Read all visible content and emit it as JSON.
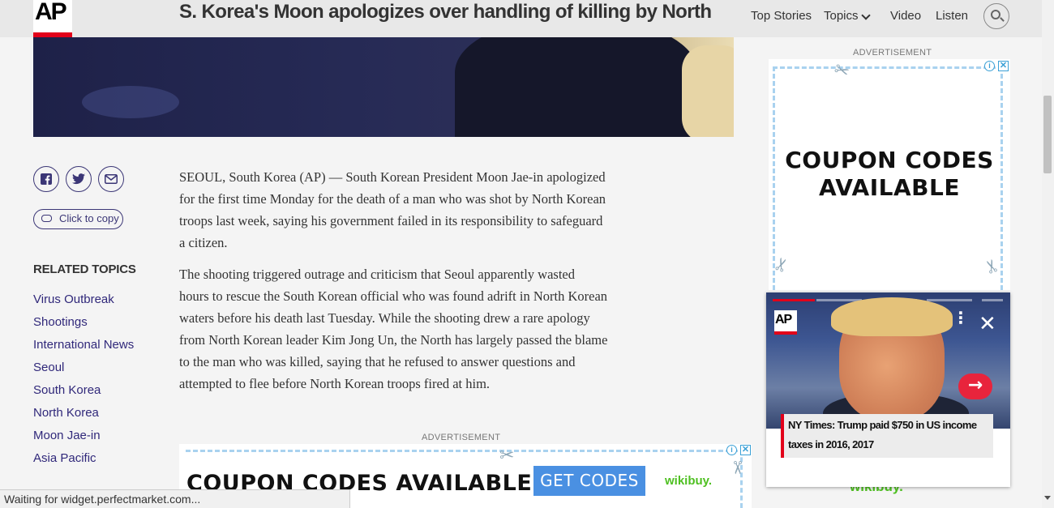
{
  "header": {
    "logo_text": "AP",
    "headline": "S. Korea's Moon apologizes over handling of killing by North",
    "nav": {
      "top_stories": "Top Stories",
      "topics": "Topics",
      "video": "Video",
      "listen": "Listen"
    }
  },
  "share": {
    "facebook_icon": "facebook-icon",
    "twitter_icon": "twitter-icon",
    "email_icon": "mail-icon",
    "copy_label": "Click to copy"
  },
  "related_topics": {
    "heading": "RELATED TOPICS",
    "items": [
      "Virus Outbreak",
      "Shootings",
      "International News",
      "Seoul",
      "South Korea",
      "North Korea",
      "Moon Jae-in",
      "Asia Pacific"
    ]
  },
  "article": {
    "paragraph_1_lines": [
      "SEOUL, South Korea (AP) — South Korean President Moon Jae-in apologized",
      "for the first time Monday for the death of a man who was shot by North Korean",
      "troops last week, saying his government failed in its responsibility to safeguard",
      "a citizen."
    ],
    "paragraph_2_lines": [
      "The shooting triggered outrage and criticism that Seoul apparently wasted",
      "hours to rescue the South Korean official who was found adrift in North Korean",
      "waters before his death last Tuesday. While the shooting drew a rare apology",
      "from North Korean leader Kim Jong Un, the North has largely passed the blame",
      "to the man who was killed, saying that he refused to answer questions and",
      "attempted to flee before North Korean troops fired at him."
    ]
  },
  "ads": {
    "label": "ADVERTISEMENT",
    "bottom": {
      "coupon_text": "COUPON CODES AVAILABLE",
      "button_label": "GET CODES",
      "brand": "wikibuy."
    },
    "right": {
      "coupon_line_1": "COUPON CODES",
      "coupon_line_2": "AVAILABLE",
      "brand": "wikibuy."
    },
    "adchoices_info": "i",
    "adchoices_close": "✕"
  },
  "video_widget": {
    "logo_text": "AP",
    "caption": "NY Times: Trump paid $750 in US income taxes in 2016, 2017",
    "kebab_glyph": "⋮",
    "close_glyph": "✕",
    "next_glyph": "→"
  },
  "status_bar": {
    "text": "Waiting for widget.perfectmarket.com..."
  },
  "colors": {
    "ap_red": "#e2001a",
    "link_purple": "#30287a",
    "wikibuy_green": "#4fc022",
    "button_blue": "#4a90e2"
  }
}
